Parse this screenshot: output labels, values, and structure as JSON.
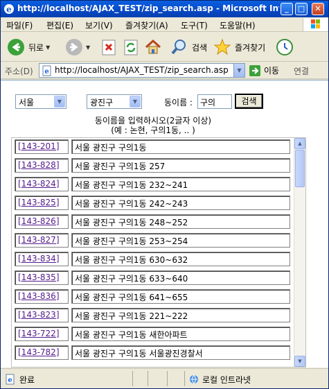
{
  "window": {
    "title": "http://localhost/AJAX_TEST/zip_search.asp - Microsoft Internet E..."
  },
  "titlebar_buttons": {
    "minimize": "_",
    "maximize": "□",
    "close": "✕"
  },
  "menu": [
    "파일(F)",
    "편집(E)",
    "보기(V)",
    "즐겨찾기(A)",
    "도구(T)",
    "도움말(H)"
  ],
  "toolbar": {
    "back_label": "뒤로",
    "search_label": "검색",
    "favorites_label": "즐겨찾기",
    "dropdown_glyph": "▼"
  },
  "address": {
    "label": "주소(D)",
    "url": "http://localhost/AJAX_TEST/zip_search.asp",
    "go_label": "이동",
    "links_label": "연결",
    "dropdown_glyph": "▼"
  },
  "form": {
    "province": "서울",
    "district": "광진구",
    "dong_label": "동이름 :",
    "dong_value": "구의",
    "search_button": "검색",
    "hint_line1": "동이름을 입력하시오(2글자 이상)",
    "hint_line2": "(예 : 논현, 구의1동, .. )",
    "select_arrow": "▼"
  },
  "results": [
    {
      "code": "[143-201]",
      "address": "서울 광진구 구의1동"
    },
    {
      "code": "[143-828]",
      "address": "서울 광진구 구의1동 257"
    },
    {
      "code": "[143-824]",
      "address": "서울 광진구 구의1동 232~241"
    },
    {
      "code": "[143-825]",
      "address": "서울 광진구 구의1동 242~243"
    },
    {
      "code": "[143-826]",
      "address": "서울 광진구 구의1동 248~252"
    },
    {
      "code": "[143-827]",
      "address": "서울 광진구 구의1동 253~254"
    },
    {
      "code": "[143-834]",
      "address": "서울 광진구 구의1동 630~632"
    },
    {
      "code": "[143-835]",
      "address": "서울 광진구 구의1동 633~640"
    },
    {
      "code": "[143-836]",
      "address": "서울 광진구 구의1동 641~655"
    },
    {
      "code": "[143-823]",
      "address": "서울 광진구 구의1동 221~222"
    },
    {
      "code": "[143-722]",
      "address": "서울 광진구 구의1동 새한아파트"
    },
    {
      "code": "[143-782]",
      "address": "서울 광진구 구의1동 서울광진경찰서"
    }
  ],
  "scrollbar": {
    "up": "▲",
    "down": "▼"
  },
  "status": {
    "text": "완료",
    "zone": "로컬 인트라넷"
  }
}
